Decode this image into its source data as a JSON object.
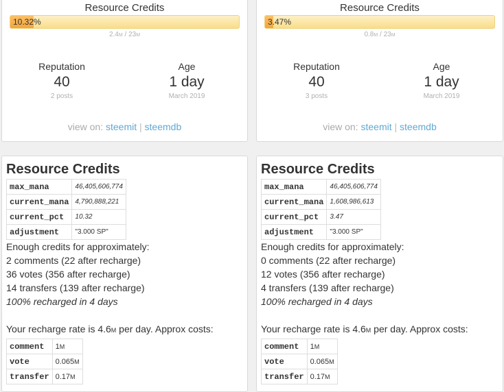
{
  "left": {
    "summary": {
      "rc_title": "Resource Credits",
      "rc_percent_label": "10.32%",
      "rc_percent": 10.32,
      "rc_current": "2.4",
      "rc_max": "23",
      "unit": "M",
      "ratio_sep": "/",
      "reputation_label": "Reputation",
      "reputation_value": "40",
      "reputation_sub": "2 posts",
      "age_label": "Age",
      "age_value": "1 day",
      "age_sub": "March 2019",
      "view_on": "view on:",
      "link1": "steemit",
      "sep": "|",
      "link2": "steemdb"
    },
    "details": {
      "title": "Resource Credits",
      "rows": [
        {
          "key": "max_mana",
          "value": "46,405,606,774"
        },
        {
          "key": "current_mana",
          "value": "4,790,888,221"
        },
        {
          "key": "current_pct",
          "value": "10.32"
        },
        {
          "key": "adjustment",
          "value": "\"3.000 SP\""
        }
      ],
      "enough": "Enough credits for approximately:",
      "comments": "2 comments (22 after recharge)",
      "votes": "36 votes (356 after recharge)",
      "transfers": "14 transfers (139 after recharge)",
      "recharged": "100% recharged in 4 days",
      "rate_pre": "Your recharge rate is 4.6",
      "rate_unit": "M",
      "rate_post": " per day. Approx costs:",
      "costs": [
        {
          "key": "comment",
          "value": "1",
          "unit": "M"
        },
        {
          "key": "vote",
          "value": "0.065",
          "unit": "M"
        },
        {
          "key": "transfer",
          "value": "0.17",
          "unit": "M"
        }
      ]
    }
  },
  "right": {
    "summary": {
      "rc_title": "Resource Credits",
      "rc_percent_label": "3.47%",
      "rc_percent": 3.47,
      "rc_current": "0.8",
      "rc_max": "23",
      "unit": "M",
      "ratio_sep": "/",
      "reputation_label": "Reputation",
      "reputation_value": "40",
      "reputation_sub": "3 posts",
      "age_label": "Age",
      "age_value": "1 day",
      "age_sub": "March 2019",
      "view_on": "view on:",
      "link1": "steemit",
      "sep": "|",
      "link2": "steemdb"
    },
    "details": {
      "title": "Resource Credits",
      "rows": [
        {
          "key": "max_mana",
          "value": "46,405,606,774"
        },
        {
          "key": "current_mana",
          "value": "1,608,986,613"
        },
        {
          "key": "current_pct",
          "value": "3.47"
        },
        {
          "key": "adjustment",
          "value": "\"3.000 SP\""
        }
      ],
      "enough": "Enough credits for approximately:",
      "comments": "0 comments (22 after recharge)",
      "votes": "12 votes (356 after recharge)",
      "transfers": "4 transfers (139 after recharge)",
      "recharged": "100% recharged in 4 days",
      "rate_pre": "Your recharge rate is 4.6",
      "rate_unit": "M",
      "rate_post": " per day. Approx costs:",
      "costs": [
        {
          "key": "comment",
          "value": "1",
          "unit": "M"
        },
        {
          "key": "vote",
          "value": "0.065",
          "unit": "M"
        },
        {
          "key": "transfer",
          "value": "0.17",
          "unit": "M"
        }
      ]
    }
  },
  "colors": {
    "bar_fill": "#f3a53a",
    "bar_track": "#f9dd8a",
    "link": "#5fa8d3"
  }
}
